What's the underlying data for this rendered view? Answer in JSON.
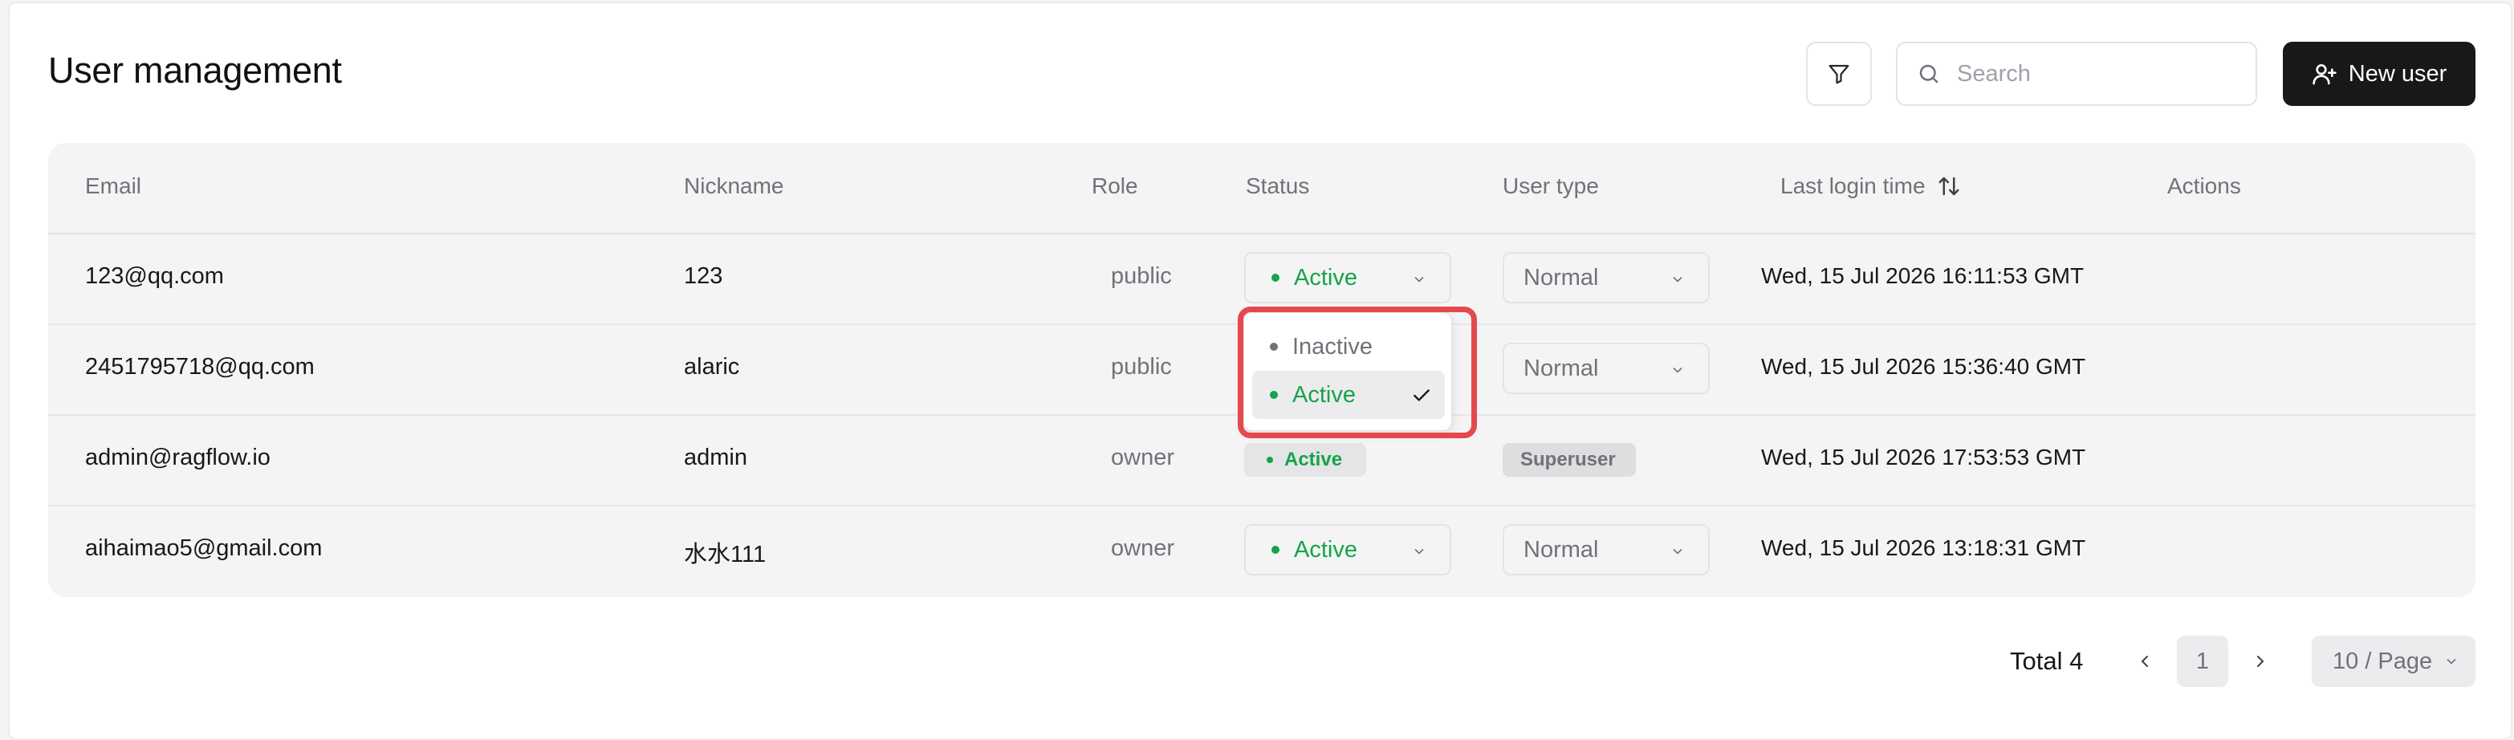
{
  "header": {
    "title": "User management",
    "search_placeholder": "Search",
    "new_user_label": "New user"
  },
  "table": {
    "columns": {
      "email": "Email",
      "nickname": "Nickname",
      "role": "Role",
      "status": "Status",
      "user_type": "User type",
      "last_login": "Last login time",
      "actions": "Actions"
    },
    "rows": [
      {
        "email": "123@qq.com",
        "nickname": "123",
        "role": "public",
        "status": "Active",
        "user_type": "Normal",
        "last_login": "Wed, 15 Jul 2026 16:11:53 GMT"
      },
      {
        "email": "2451795718@qq.com",
        "nickname": "alaric",
        "role": "public",
        "status": "Active",
        "user_type": "Normal",
        "last_login": "Wed, 15 Jul 2026 15:36:40 GMT"
      },
      {
        "email": "admin@ragflow.io",
        "nickname": "admin",
        "role": "owner",
        "status": "Active",
        "user_type": "Superuser",
        "last_login": "Wed, 15 Jul 2026 17:53:53 GMT"
      },
      {
        "email": "aihaimao5@gmail.com",
        "nickname": "水水111",
        "role": "owner",
        "status": "Active",
        "user_type": "Normal",
        "last_login": "Wed, 15 Jul 2026 13:18:31 GMT"
      }
    ]
  },
  "status_dropdown": {
    "options": [
      "Inactive",
      "Active"
    ],
    "selected": "Active"
  },
  "pagination": {
    "total_label": "Total 4",
    "current_page": "1",
    "page_size": "10 / Page"
  },
  "colors": {
    "active": "#16a34a",
    "muted": "#71717a",
    "primary_button": "#18181b",
    "highlight": "#e5484d"
  },
  "icons": {
    "filter": "filter-icon",
    "search": "search-icon",
    "new_user": "user-plus-icon",
    "sort": "sort-arrows-icon",
    "chevron": "chevron-down-icon",
    "check": "check-icon"
  }
}
